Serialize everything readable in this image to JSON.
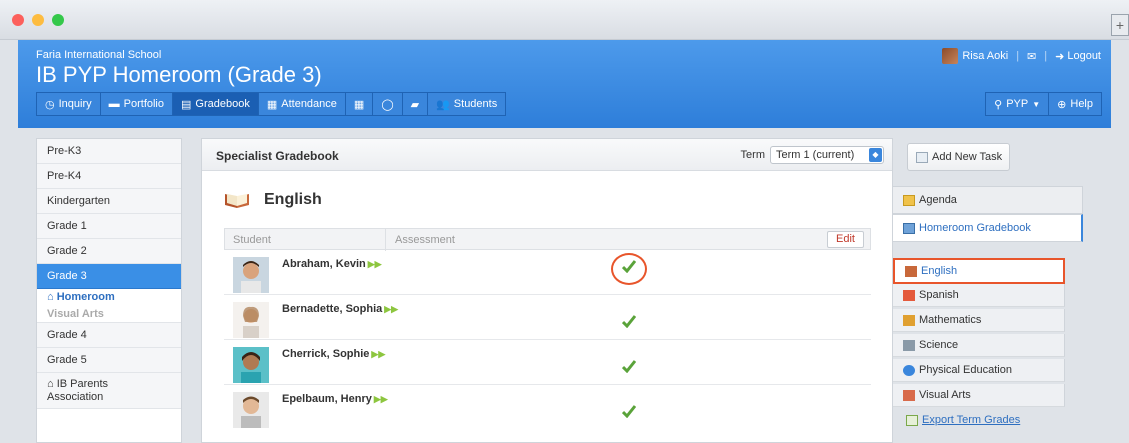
{
  "header": {
    "school": "Faria International School",
    "title": "IB PYP Homeroom (Grade 3)",
    "user": "Risa Aoki",
    "logout": "Logout",
    "nav": [
      {
        "label": "Inquiry",
        "icon": "compass-icon"
      },
      {
        "label": "Portfolio",
        "icon": "briefcase-icon"
      },
      {
        "label": "Gradebook",
        "icon": "gradebook-icon"
      },
      {
        "label": "Attendance",
        "icon": "calendar-icon"
      },
      {
        "label": "",
        "icon": "grid-icon"
      },
      {
        "label": "",
        "icon": "chat-icon"
      },
      {
        "label": "",
        "icon": "folder-icon"
      },
      {
        "label": "Students",
        "icon": "users-icon"
      }
    ],
    "pyp": "PYP",
    "help": "Help"
  },
  "sidebar": {
    "items": [
      "Pre-K3",
      "Pre-K4",
      "Kindergarten",
      "Grade 1",
      "Grade 2",
      "Grade 3"
    ],
    "sub_homeroom": "Homeroom",
    "sub_visual": "Visual Arts",
    "after": [
      "Grade 4",
      "Grade 5"
    ],
    "parents_line1": "IB Parents",
    "parents_line2": "Association"
  },
  "gradebook": {
    "title": "Specialist Gradebook",
    "term_label": "Term",
    "term_value": "Term 1 (current)",
    "subject": "English",
    "col_student": "Student",
    "col_assessment": "Assessment",
    "edit": "Edit",
    "students": [
      "Abraham, Kevin",
      "Bernadette, Sophia",
      "Cherrick, Sophie",
      "Epelbaum, Henry"
    ]
  },
  "right": {
    "add_task": "Add New Task",
    "tab_agenda": "Agenda",
    "tab_homeroom": "Homeroom Gradebook",
    "subjects": [
      "English",
      "Spanish",
      "Mathematics",
      "Science",
      "Physical Education",
      "Visual Arts"
    ],
    "export": "Export Term Grades"
  },
  "colors": {
    "accent": "#3a86dc",
    "highlight": "#e8552b",
    "check": "#5aa33a"
  }
}
